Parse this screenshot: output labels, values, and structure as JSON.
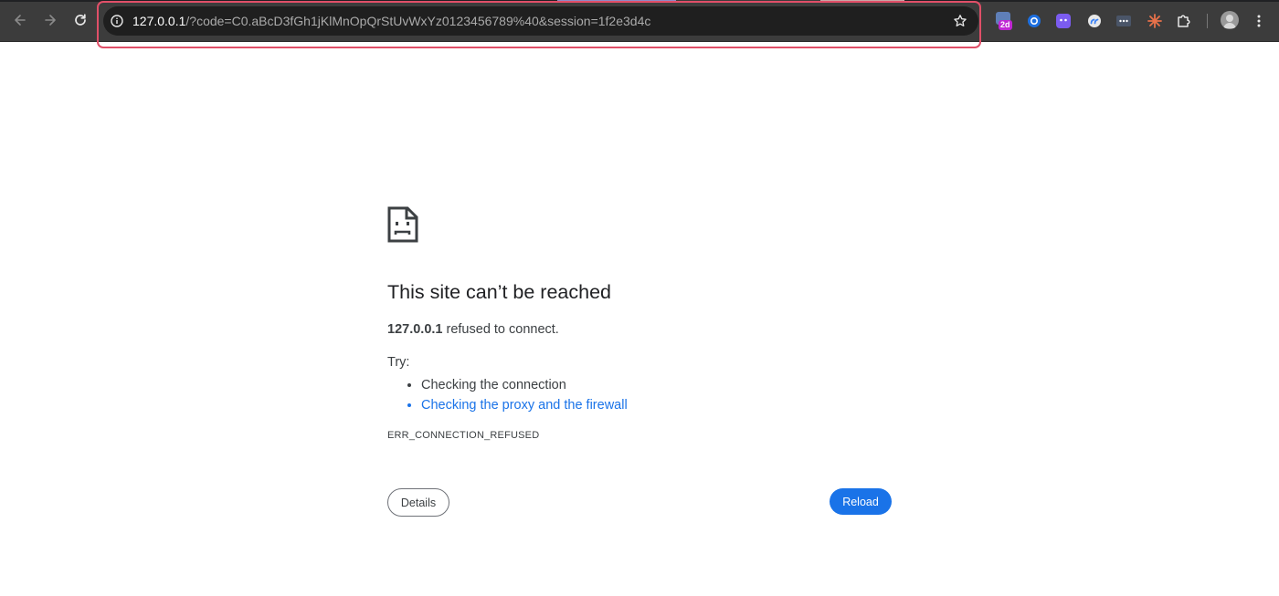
{
  "browser": {
    "url_host": "127.0.0.1",
    "url_rest": "/?code=C0.aBcD3fGh1jKlMnOpQrStUvWxYz0123456789%40&session=1f2e3d4c",
    "extension_badge": "2d",
    "highlight_color": "#e04f68"
  },
  "error_page": {
    "title": "This site can’t be reached",
    "host": "127.0.0.1",
    "message": " refused to connect.",
    "try_label": "Try:",
    "suggestions": [
      {
        "text": "Checking the connection",
        "is_link": false
      },
      {
        "text": "Checking the proxy and the firewall",
        "is_link": true
      }
    ],
    "error_code": "ERR_CONNECTION_REFUSED",
    "details_button": "Details",
    "reload_button": "Reload",
    "accent_color": "#1a73e8"
  }
}
